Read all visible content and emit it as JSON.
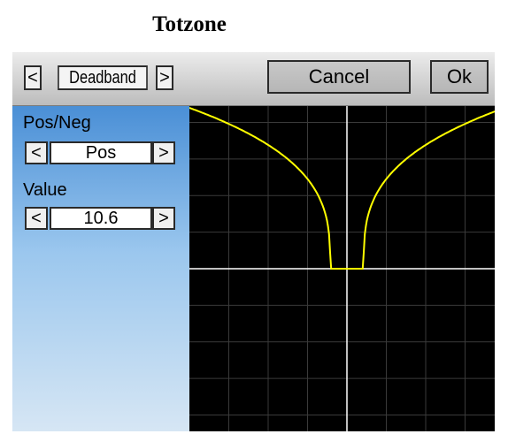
{
  "caption": "Totzone",
  "header": {
    "prev_arrow": "<",
    "mode_label": "Deadband",
    "next_arrow": ">",
    "cancel_label": "Cancel",
    "ok_label": "Ok"
  },
  "settings": {
    "posneg_label": "Pos/Neg",
    "posneg_value": "Pos",
    "value_label": "Value",
    "value_value": "10.6",
    "dec_arrow": "<",
    "inc_arrow": ">"
  },
  "graph": {
    "background": "#000000",
    "grid_color": "#3a3a3a",
    "axis_color": "#ffffff",
    "curve_color": "#ffff00",
    "curve": {
      "type": "deadband",
      "mode": "Pos",
      "deadband": 10.6
    }
  }
}
